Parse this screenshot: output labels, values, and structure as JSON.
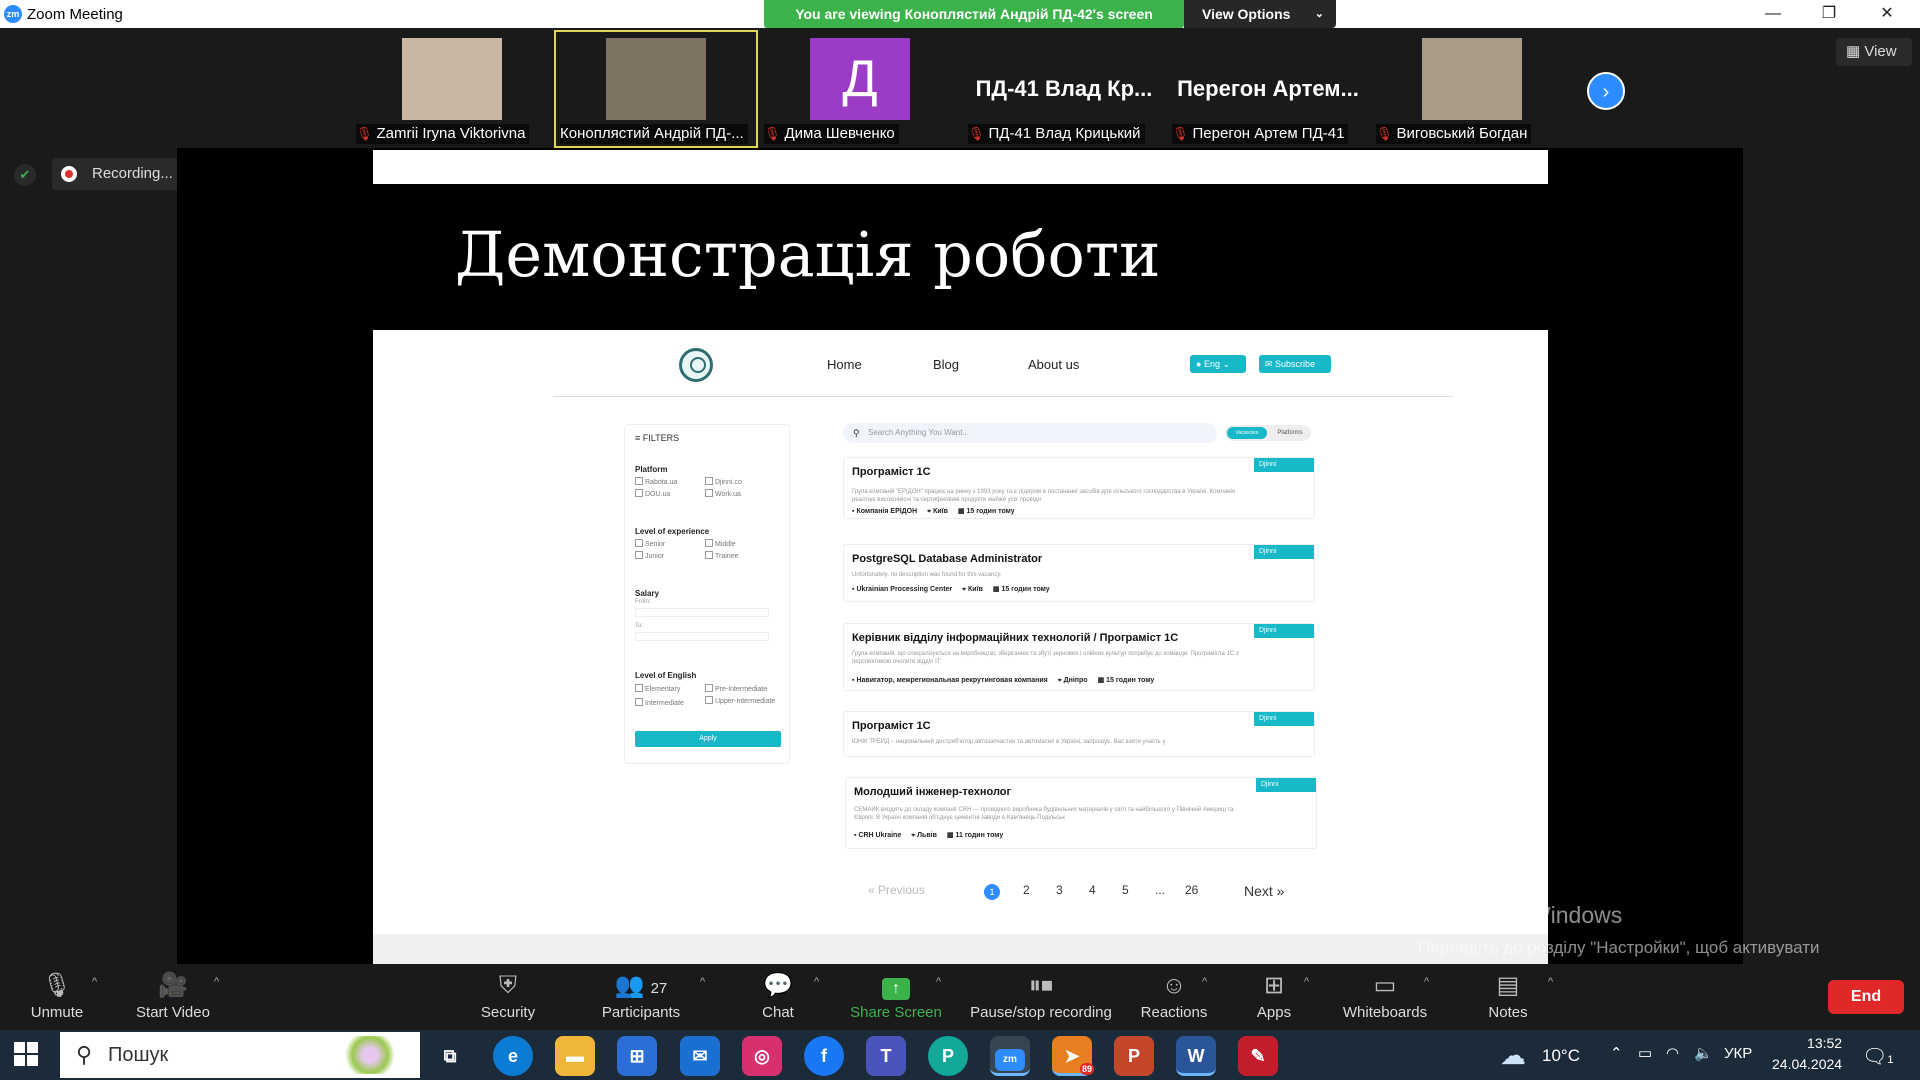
{
  "window": {
    "title": "Zoom Meeting",
    "logo": "zm",
    "minimize": "—",
    "restore": "❐",
    "close": "✕"
  },
  "banner": {
    "viewing": "You are viewing Конoплястий Андрій ПД-42's screen",
    "view_options": "View Options"
  },
  "participants": [
    {
      "name": "Zamrii Iryna Viktorivna",
      "muted": true,
      "display": "photo",
      "color": "#c9b7a3"
    },
    {
      "name": "Конoплястий Андрій ПД-...",
      "muted": false,
      "display": "photo",
      "color": "#7f7463",
      "active": true
    },
    {
      "name": "Дима Шевченко",
      "muted": true,
      "display": "avatar",
      "avatar_letter": "Д",
      "color": "#9b3bc6"
    },
    {
      "name": "ПД-41 Влад Крицький",
      "muted": true,
      "display": "text",
      "big_name": "ПД-41 Влад Кр..."
    },
    {
      "name": "Перегон Артем ПД-41",
      "muted": true,
      "display": "text",
      "big_name": "Перегон Артем..."
    },
    {
      "name": "Виговський Богдан",
      "muted": true,
      "display": "photo",
      "color": "#a99b87"
    }
  ],
  "view_button": "View",
  "recording": {
    "label": "Recording...",
    "pause_icon": "❚❚"
  },
  "slide": {
    "title": "Демонстрація роботи"
  },
  "site": {
    "nav": [
      "Home",
      "Blog",
      "About us"
    ],
    "lang": "Eng",
    "subscribe": "Subscribe",
    "filters": {
      "header": "FILTERS",
      "platform_label": "Platform",
      "platforms": [
        "Rabota.ua",
        "Djinni.co",
        "DOU.ua",
        "Work.ua"
      ],
      "experience_label": "Level of experience",
      "experience": [
        "Senior",
        "Middle",
        "Junior",
        "Trainee"
      ],
      "salary_label": "Salary",
      "from_label": "From:",
      "to_label": "To:",
      "english_label": "Level of English",
      "english": [
        "Elementary",
        "Pre-Intermediate",
        "Intermediate",
        "Upper-Intermediate"
      ],
      "apply": "Apply"
    },
    "search_placeholder": "Search Anything You Want...",
    "toggle": [
      "Vacancies",
      "Platforms"
    ],
    "jobs": [
      {
        "title": "Програміст 1С",
        "desc": "Група компаній \"ЕРІДОН\" працює на ринку з 1993 року та є лідером в постачанні засобів для сільського господарства в Україні. Компанія реалізує високоякісні та сертифіковані продукти майже усіх провідн",
        "company": "Компанія ЕРІДОН",
        "city": "Київ",
        "time": "15 годин тому",
        "badge": "Djinni"
      },
      {
        "title": "PostgreSQL Database Administrator",
        "desc": "Unfortunately, no description was found for this vacancy.",
        "company": "Ukrainian Processing Center",
        "city": "Київ",
        "time": "15 годин тому",
        "badge": "Djinni"
      },
      {
        "title": "Керівник відділу інформаційних технологій / Програміст 1С",
        "desc": "Група компаній, що спеціалізується на виробництві, зберіганню та збуті зернових і олійних культур потребує до команди: Програміста 1С з перспективою очолити відділ IT",
        "company": "Навигатор, межрегиональная рекрутинговая компания",
        "city": "Дніпро",
        "time": "15 годин тому",
        "badge": "Djinni"
      },
      {
        "title": "Програміст 1С",
        "desc": "ЮНІК ТРЕЙД – національний дистриб'ютор автозапчастин та автомасел в Україні, запрошує. Вас взяти участь у",
        "company": "",
        "city": "",
        "time": "",
        "badge": "Djinni"
      },
      {
        "title": "Молодший інженер-технолог",
        "desc": "СЕМАЙК входить до складу компанії CRH — провідного виробника будівельних матеріалів у світі та найбільшого у Північній Америці та Європі. В Україні компанія об'єднує цементні заводи в Кам'янець-Подільськ",
        "company": "CRH Ukraine",
        "city": "Львів",
        "time": "11 годин тому",
        "badge": "Djinni"
      }
    ],
    "pagination": {
      "prev": "« Previous",
      "pages": [
        "1",
        "2",
        "3",
        "4",
        "5",
        "...",
        "26"
      ],
      "current": "1",
      "next": "Next »"
    }
  },
  "activation": {
    "line1": "Активація Windows",
    "line2": "Перейдіть до розділу \"Настройки\", щоб активувати Windows."
  },
  "toolbar": {
    "unmute": "Unmute",
    "start_video": "Start Video",
    "security": "Security",
    "participants": "Participants",
    "participants_count": "27",
    "chat": "Chat",
    "share": "Share Screen",
    "pause_rec": "Pause/stop recording",
    "reactions": "Reactions",
    "apps": "Apps",
    "whiteboards": "Whiteboards",
    "notes": "Notes",
    "end": "End"
  },
  "taskbar": {
    "search": "Пошук",
    "telegram_badge": "89",
    "temp": "10°C",
    "lang": "УКР",
    "time": "13:52",
    "date": "24.04.2024",
    "notif_count": "1"
  },
  "colors": {
    "accent": "#2d8cff",
    "teal": "#17b8c8",
    "green": "#3bb34a",
    "end": "#e02828"
  }
}
